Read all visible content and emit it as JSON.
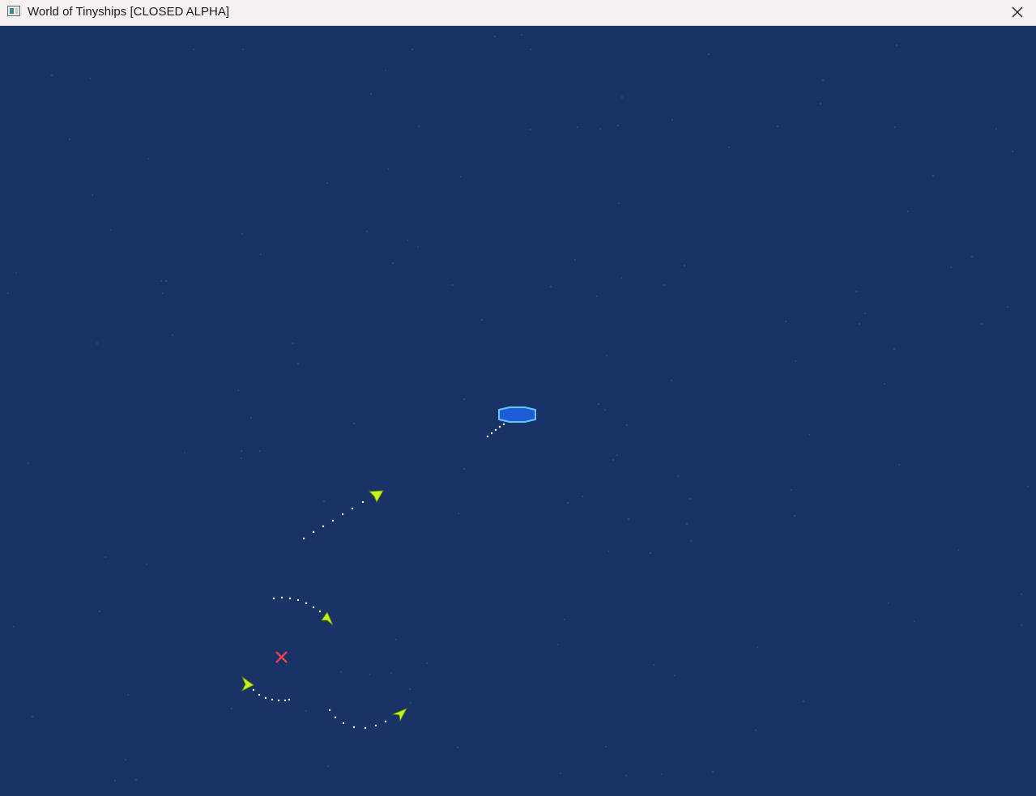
{
  "window": {
    "title": "World of Tinyships [CLOSED ALPHA]",
    "icon": "app-window-icon",
    "close_icon": "close-icon"
  },
  "colors": {
    "ocean": "#1a3366",
    "star_dot": "#3a5590",
    "player_ship_fill": "#1f5bd4",
    "player_ship_outline": "#5fc8ff",
    "enemy_ship": "#c6f21c",
    "wake_dots": "#ffffff",
    "target_marker": "#ff4444"
  },
  "entities": {
    "player_ship": "player-battleship",
    "enemy_ships": [
      "enemy-fighter",
      "enemy-fighter",
      "enemy-fighter",
      "enemy-fighter"
    ],
    "target_marker": "target-x-marker"
  }
}
